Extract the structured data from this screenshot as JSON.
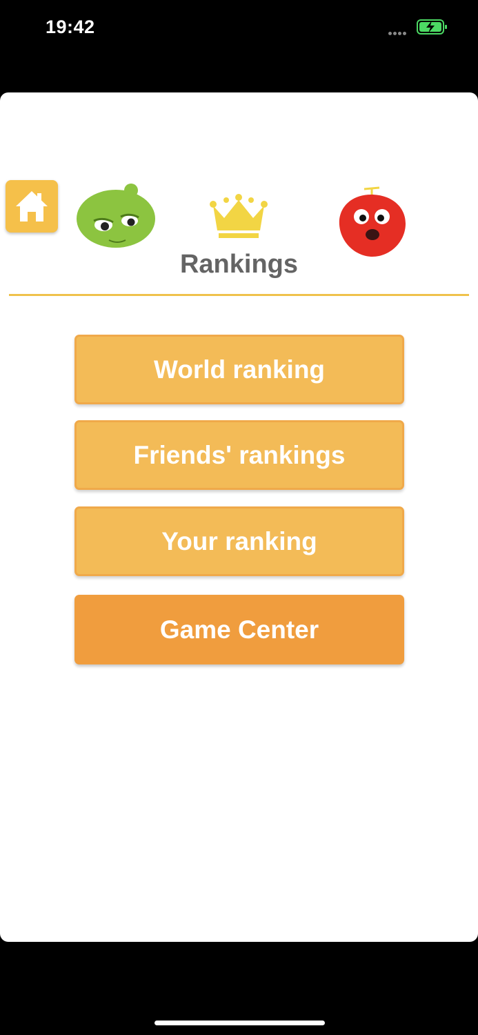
{
  "status_bar": {
    "time": "19:42"
  },
  "header": {
    "title": "Rankings"
  },
  "menu": {
    "world_ranking": "World ranking",
    "friends_rankings": "Friends' rankings",
    "your_ranking": "Your ranking",
    "game_center": "Game Center"
  },
  "colors": {
    "accent": "#f3bb57",
    "accent_dark": "#f09d3e",
    "divider": "#efc24b",
    "home_button": "#f5c04a",
    "battery": "#4cd964"
  },
  "icons": [
    "home-icon",
    "green-character-icon",
    "crown-icon",
    "red-character-icon",
    "battery-charging-icon"
  ]
}
